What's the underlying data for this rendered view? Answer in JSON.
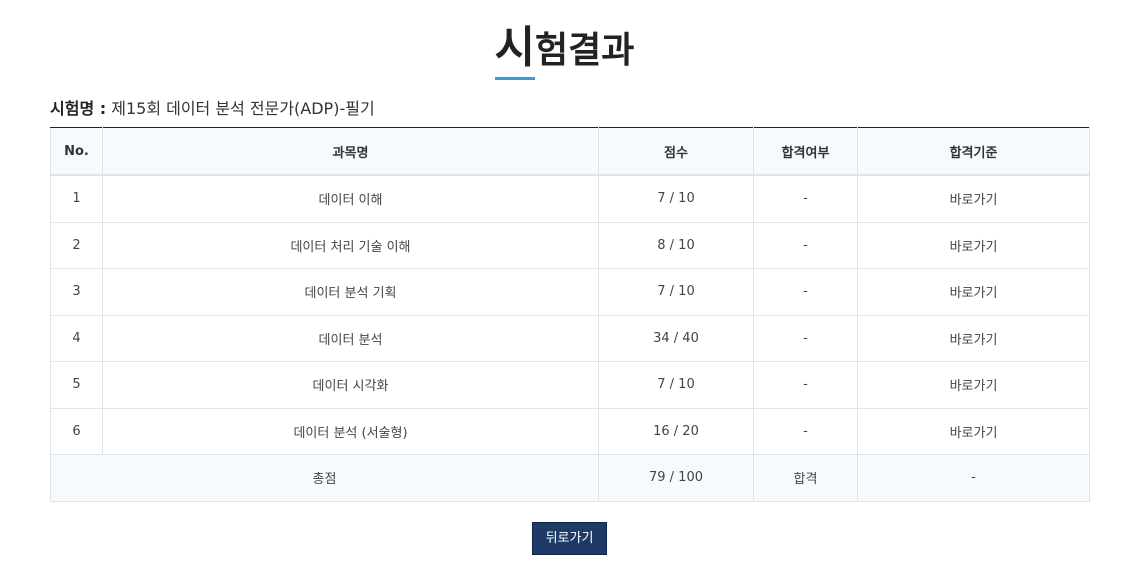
{
  "page": {
    "title_first": "시",
    "title_rest": "험결과"
  },
  "exam": {
    "label": "시험명 :",
    "name": "제15회 데이터 분석 전문가(ADP)-필기"
  },
  "table": {
    "headers": {
      "no": "No.",
      "subject": "과목명",
      "score": "점수",
      "pass": "합격여부",
      "criteria": "합격기준"
    },
    "rows": [
      {
        "no": "1",
        "subject": "데이터 이해",
        "score": "7 / 10",
        "pass": "-",
        "criteria": "바로가기"
      },
      {
        "no": "2",
        "subject": "데이터 처리 기술 이해",
        "score": "8 / 10",
        "pass": "-",
        "criteria": "바로가기"
      },
      {
        "no": "3",
        "subject": "데이터 분석 기획",
        "score": "7 / 10",
        "pass": "-",
        "criteria": "바로가기"
      },
      {
        "no": "4",
        "subject": "데이터 분석",
        "score": "34 / 40",
        "pass": "-",
        "criteria": "바로가기"
      },
      {
        "no": "5",
        "subject": "데이터 시각화",
        "score": "7 / 10",
        "pass": "-",
        "criteria": "바로가기"
      },
      {
        "no": "6",
        "subject": "데이터 분석 (서술형)",
        "score": "16 / 20",
        "pass": "-",
        "criteria": "바로가기"
      }
    ],
    "total": {
      "label": "총점",
      "score": "79 / 100",
      "pass": "합격",
      "criteria": "-"
    }
  },
  "actions": {
    "back_label": "뒤로가기"
  },
  "colors": {
    "accent_underline": "#3a9ad9",
    "button_bg": "#1d3b66",
    "header_bg": "#f7fafd"
  }
}
